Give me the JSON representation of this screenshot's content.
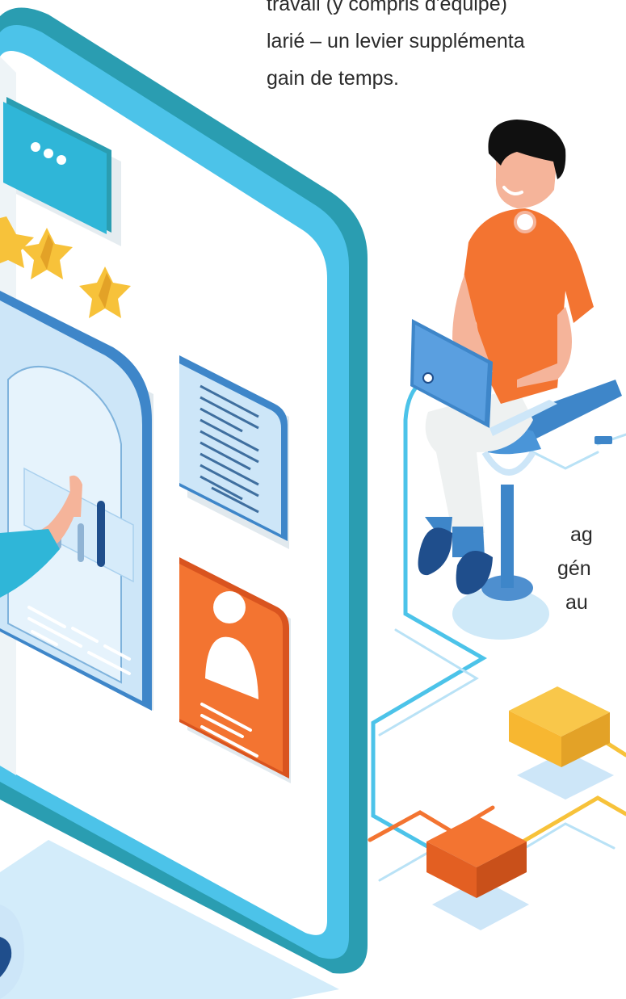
{
  "intro_text": {
    "line1": "travail (y compris d'équipe)",
    "line2": "larié – un levier supplémenta",
    "line3": "gain de temps."
  },
  "side_text": {
    "line1": "ag",
    "line2": "gén",
    "line3": "au"
  },
  "colors": {
    "phone_frame": "#4cc3e9",
    "phone_edge": "#2a9db1",
    "orange": "#f37431",
    "star_yellow": "#f7c23a",
    "doc_blue": "#c9e3f7",
    "dark_navy": "#1f4e8c"
  }
}
